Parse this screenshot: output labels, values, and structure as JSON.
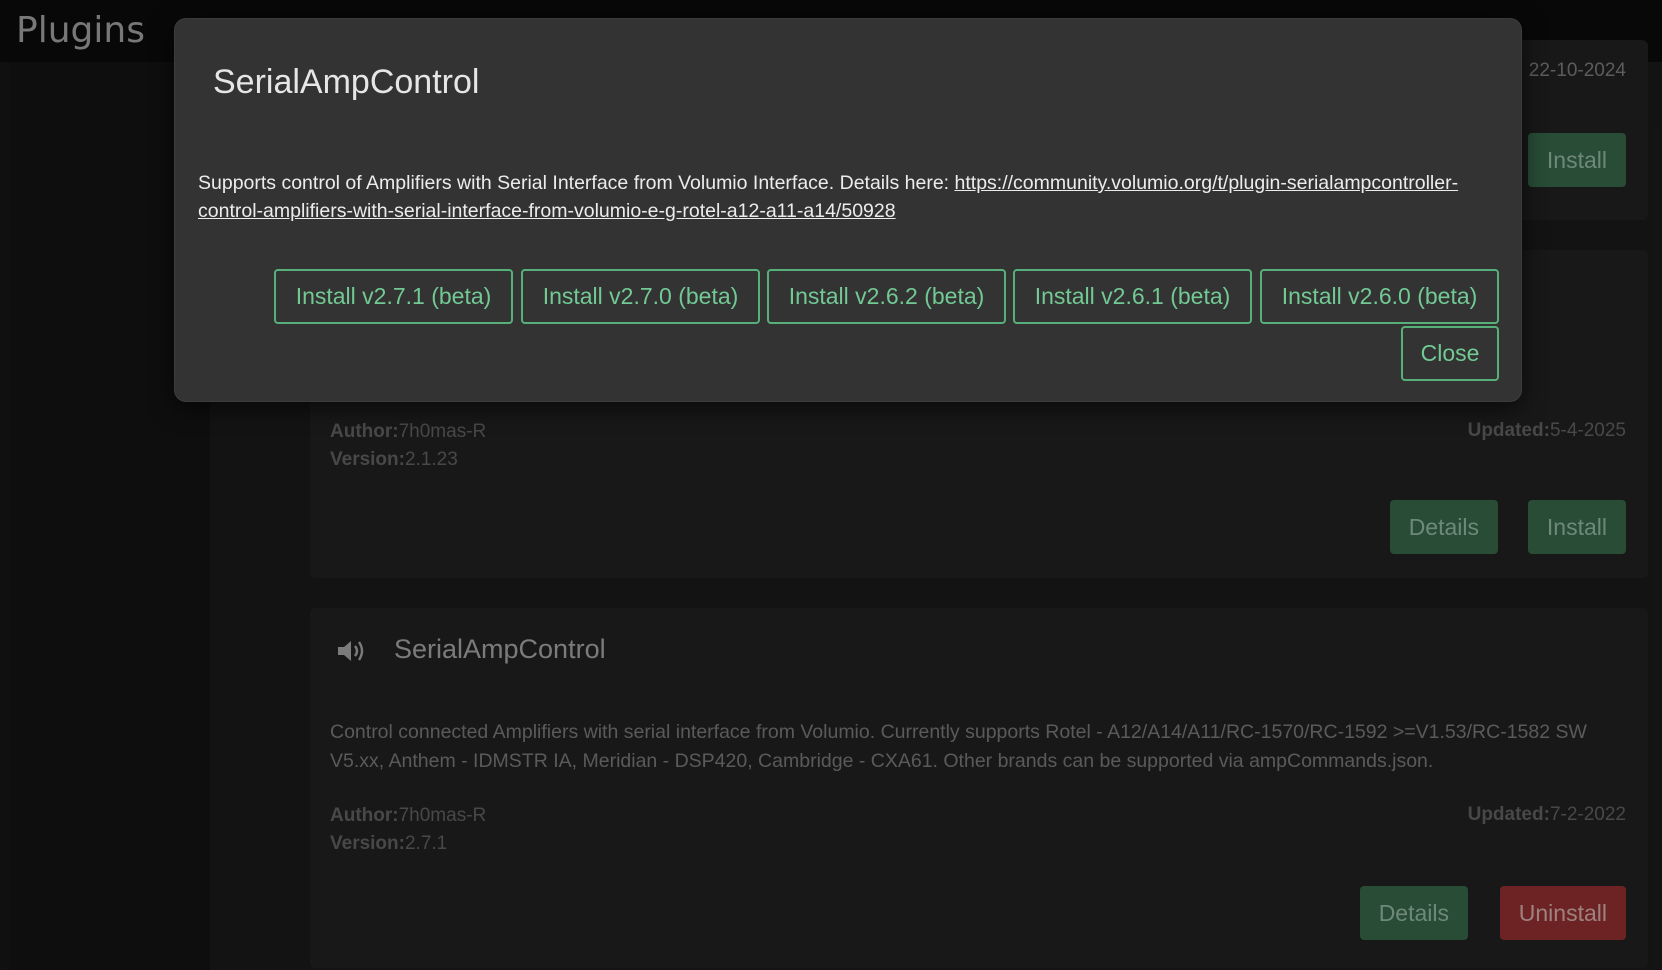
{
  "header": {
    "title": "Plugins"
  },
  "cards": [
    {
      "updated_value": "22-10-2024",
      "install_label": "Install"
    },
    {
      "author_label": "Author:",
      "author": "7h0mas-R",
      "version_label": "Version:",
      "version": "2.1.23",
      "updated_label": "Updated:",
      "updated_value": "5-4-2025",
      "details_label": "Details",
      "install_label": "Install"
    },
    {
      "title": "SerialAmpControl",
      "description": "Control connected Amplifiers with serial interface from Volumio. Currently supports Rotel - A12/A14/A11/RC-1570/RC-1592 >=V1.53/RC-1582 SW V5.xx, Anthem - IDMSTR IA, Meridian - DSP420, Cambridge - CXA61. Other brands can be supported via ampCommands.json.",
      "author_label": "Author:",
      "author": "7h0mas-R",
      "version_label": "Version:",
      "version": "2.7.1",
      "updated_label": "Updated:",
      "updated_value": "7-2-2022",
      "details_label": "Details",
      "uninstall_label": "Uninstall",
      "icon": "speaker-icon"
    }
  ],
  "modal": {
    "title": "SerialAmpControl",
    "description_prefix": "Supports control of Amplifiers with Serial Interface from Volumio Interface. Details here: ",
    "link_text": "https://community.volumio.org/t/plugin-serialampcontroller-control-amplifiers-with-serial-interface-from-volumio-e-g-rotel-a12-a11-a14/50928",
    "install_buttons": [
      "Install v2.7.1 (beta)",
      "Install v2.7.0 (beta)",
      "Install v2.6.2 (beta)",
      "Install v2.6.1 (beta)",
      "Install v2.6.0 (beta)"
    ],
    "close_label": "Close"
  },
  "colors": {
    "accent_green": "#57b07a",
    "button_green": "#3e7553",
    "button_red": "#a83636"
  }
}
